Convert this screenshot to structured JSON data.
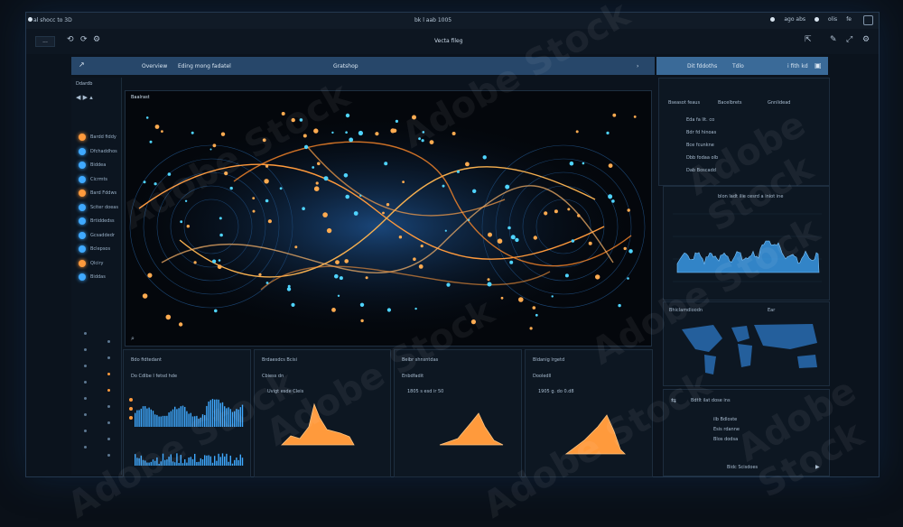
{
  "watermark": {
    "side_id": "#939100453",
    "brand": "Adobe Stock"
  },
  "titlebar": {
    "left": "al shocc to 3D",
    "center": "bk l aab 1005",
    "right1": "ago abs",
    "right2": "olis",
    "right3": "fe"
  },
  "toolbar": {
    "btn": "...",
    "title": "Vecta fileg"
  },
  "header": {
    "nav1": "Overview",
    "nav2": "Eding mong fadatel",
    "nav3": "Gratshop",
    "nav4": "›",
    "panel1": "Dit fddoths",
    "panel2": "Tdlo",
    "panel3": "i fith kd"
  },
  "map": {
    "label": "Baalrast"
  },
  "nav": {
    "top": "Ddardb",
    "items": [
      "Bardd fiddy",
      "Dfchaddhos",
      "Biddea",
      "Cicrmts",
      "Bard Fddws",
      "Sciter doeas",
      "Brtiddedss",
      "Gcsaddedr",
      "Bclepsos",
      "Qlciry",
      "Biddas"
    ]
  },
  "cards": [
    {
      "title": "Bdo fidtedant",
      "sub": "Do Cdlbe I fetsd hde"
    },
    {
      "title": "Brdaesdcs Bcisi",
      "sub": "Cbiess dn",
      "stat": "Uvigt esde Cleis"
    },
    {
      "title": "Beibr shnsntdas",
      "sub": "Enbdfadit",
      "stat": "1805 s esd ir 50"
    },
    {
      "title": "Bldanig lrgetd",
      "sub": "Dooledll",
      "stat": "1905 g. do 0.d8"
    }
  ],
  "right": {
    "tabs": [
      "Bseasot feaus",
      "Bacelbrets",
      "Gnnlidead"
    ],
    "rows": [
      "Eda fa lit. co",
      "Bdr fd hinoas",
      "Bce fcunkne",
      "Dbb fodaa olb",
      "Dab Boscadd"
    ],
    "wave_title": "blon ladt ilie cesrd a iniot ine",
    "map_title": "Bhiclamdloodn",
    "map_tag": "Ear",
    "bottom_title": "Bdtlt ilat dose ins",
    "bottom_rows": [
      "ilb Bdloste",
      "Esis rdanne",
      "Blos dodsa"
    ],
    "bottom_footer": "Bidc Scisdoes"
  },
  "colors": {
    "accent": "#ff9a3c",
    "blue": "#3fa9ff",
    "panel": "#0d1722",
    "header": "#27476a"
  }
}
